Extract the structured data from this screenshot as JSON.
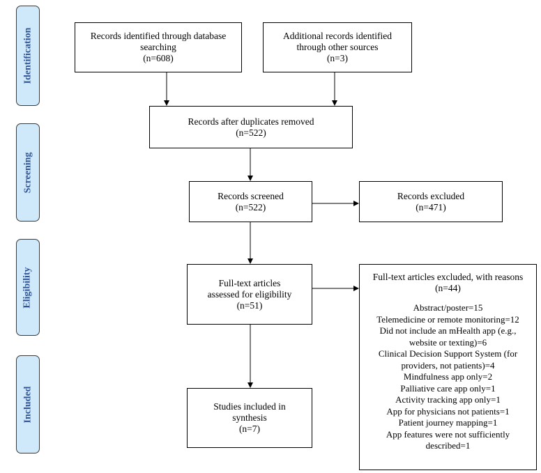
{
  "stages": [
    "Identification",
    "Screening",
    "Eligibility",
    "Included"
  ],
  "boxes": {
    "db_search": {
      "line1": "Records identified through database searching",
      "count": "(n=608)"
    },
    "other_sources": {
      "line1": "Additional records identified through other sources",
      "count": "(n=3)"
    },
    "duplicates_removed": {
      "line1": "Records after duplicates removed",
      "count": "(n=522)"
    },
    "screened": {
      "line1": "Records screened",
      "count": "(n=522)"
    },
    "excluded": {
      "line1": "Records excluded",
      "count": "(n=471)"
    },
    "fulltext_assessed": {
      "line1": "Full-text articles assessed for eligibility",
      "count": "(n=51)"
    },
    "fulltext_excluded": {
      "line1": "Full-text articles excluded, with reasons",
      "count": "(n=44)",
      "reasons": [
        "Abstract/poster=15",
        "Telemedicine or remote monitoring=12",
        "Did not include an mHealth app (e.g., website or texting)=6",
        "Clinical Decision Support System (for providers, not patients)=4",
        "Mindfulness app only=2",
        "Palliative care app only=1",
        "Activity tracking app only=1",
        "App for physicians not patients=1",
        "Patient journey mapping=1",
        "App features were not sufficiently described=1"
      ]
    },
    "included": {
      "line1": "Studies included in synthesis",
      "count": "(n=7)"
    }
  },
  "colors": {
    "stage_fill": "#cfe9fb",
    "stage_text": "#2f5597"
  }
}
